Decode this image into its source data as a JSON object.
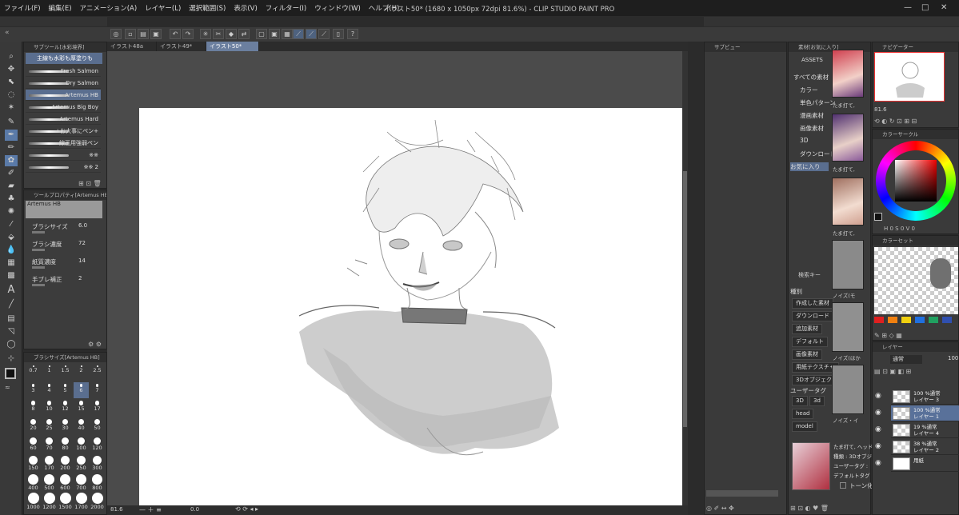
{
  "window": {
    "title": "イラスト50* (1680 x 1050px 72dpi 81.6%) - CLIP STUDIO PAINT PRO"
  },
  "menu": [
    "ファイル(F)",
    "編集(E)",
    "アニメーション(A)",
    "レイヤー(L)",
    "選択範囲(S)",
    "表示(V)",
    "フィルター(I)",
    "ウィンドウ(W)",
    "ヘルプ(H)"
  ],
  "subtool": {
    "header": "サブツール[水彩境界]",
    "group_label": "主線も水彩も厚塗りも",
    "brushes": [
      "Fresh Salmon",
      "Dry Salmon",
      "Artemus HB",
      "Artemus Big Boy",
      "Artemus Hard",
      "+お大事にペン+",
      "線画用強弱ペン",
      "※※",
      "※※ 2"
    ],
    "selected_index": 2
  },
  "tool_property": {
    "header": "ツールプロパティ[Artemus HB]",
    "brush_name": "Artemus HB",
    "rows": [
      {
        "label": "ブラシサイズ",
        "value": "6.0"
      },
      {
        "label": "ブラシ濃度",
        "value": "72"
      },
      {
        "label": "紙質濃度",
        "value": "14"
      },
      {
        "label": "手ブレ補正",
        "value": "2"
      }
    ]
  },
  "brush_size": {
    "header": "ブラシサイズ[Artemus HB]",
    "sizes": [
      "0.7",
      "1",
      "1.5",
      "2",
      "2.5",
      "3",
      "4",
      "5",
      "6",
      "7",
      "8",
      "10",
      "12",
      "15",
      "17",
      "20",
      "25",
      "30",
      "40",
      "50",
      "60",
      "70",
      "80",
      "100",
      "120",
      "150",
      "170",
      "200",
      "250",
      "300",
      "400",
      "500",
      "600",
      "700",
      "800",
      "1000",
      "1200",
      "1500",
      "1700",
      "2000"
    ]
  },
  "canvas": {
    "tabs": [
      "イラスト48a",
      "イラスト49*",
      "イラスト50*"
    ],
    "active_tab": 2,
    "zoom": "81.6",
    "rotation": "0.0"
  },
  "subview": {
    "header": "サブビュー"
  },
  "materials": {
    "header": "素材[お気に入り]",
    "tree_root": "ASSETS",
    "tree": [
      "すべての素材",
      "カラー",
      "単色パターン",
      "漫画素材",
      "画像素材",
      "3D",
      "ダウンロード",
      "お気に入り"
    ],
    "selected_tree": 7,
    "search_label": "検索キー",
    "kind_label": "種別",
    "kinds": [
      "作成した素材",
      "ダウンロード",
      "追加素材",
      "デフォルト",
      "画像素材",
      "用紙テクスチャ",
      "3Dオブジェクト"
    ],
    "user_tag_label": "ユーザータグ",
    "tags": [
      "3D",
      "3d",
      "head",
      "model"
    ],
    "thumb_labels": [
      "たま打て,",
      "たま打て,",
      "たま打て,",
      "ノイズ(モ",
      "ノイズ(ほか",
      "ノイズ・イ"
    ],
    "detail": [
      "たま打て, ヘッド",
      "種類 : 3Dオブジ",
      "ユーザータグ : ",
      "デフォルトタグ : "
    ],
    "tone_label": "トーン化"
  },
  "navigator": {
    "header": "ナビゲーター",
    "zoom": "81.6"
  },
  "color_wheel": {
    "header": "カラーサークル"
  },
  "color_set": {
    "header": "カラーセット",
    "swatches": [
      "#e02020",
      "#f08010",
      "#f0d010",
      "#2070e0",
      "#20a060",
      "#3050b0"
    ]
  },
  "layers": {
    "header": "レイヤー",
    "blend": "通常",
    "opacity": "100",
    "rows": [
      {
        "line1": "100 %通常",
        "line2": "レイヤー 3"
      },
      {
        "line1": "100 %通常",
        "line2": "レイヤー 1"
      },
      {
        "line1": "19 %通常",
        "line2": "レイヤー 4"
      },
      {
        "line1": "38 %通常",
        "line2": "レイヤー 2"
      },
      {
        "line1": "",
        "line2": "用紙"
      }
    ],
    "selected_index": 1
  },
  "colors": {
    "accent": "#5a7aa8",
    "background": "#2b2b2b",
    "panel": "#3c3c3c"
  }
}
